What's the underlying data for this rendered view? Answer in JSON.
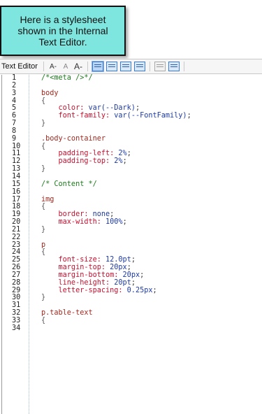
{
  "callout": {
    "text": "Here is a stylesheet shown in the Internal Text Editor."
  },
  "toolbar": {
    "title": "Text Editor",
    "font_decrease": "A-",
    "font_reset": "A",
    "font_increase": "A-"
  },
  "colors": {
    "callout_bg": "#7fe5df",
    "comment": "#1e7a1e",
    "selector": "#a4281e",
    "property": "#c8102e",
    "value": "#1d3aa6"
  },
  "lines": [
    {
      "n": "1",
      "tokens": [
        [
          "comment",
          "/*<meta />*/"
        ]
      ]
    },
    {
      "n": "2",
      "tokens": []
    },
    {
      "n": "3",
      "tokens": [
        [
          "sel",
          "body"
        ]
      ]
    },
    {
      "n": "4",
      "tokens": [
        [
          "brace",
          "{"
        ]
      ]
    },
    {
      "n": "5",
      "tokens": [
        [
          "prop",
          "    color: "
        ],
        [
          "val",
          "var(--Dark)"
        ],
        [
          "punct",
          ";"
        ]
      ]
    },
    {
      "n": "6",
      "tokens": [
        [
          "prop",
          "    font-family: "
        ],
        [
          "val",
          "var(--FontFamily)"
        ],
        [
          "punct",
          ";"
        ]
      ]
    },
    {
      "n": "7",
      "tokens": [
        [
          "brace",
          "}"
        ]
      ]
    },
    {
      "n": "8",
      "tokens": []
    },
    {
      "n": "9",
      "tokens": [
        [
          "sel",
          ".body-container"
        ]
      ]
    },
    {
      "n": "10",
      "tokens": [
        [
          "brace",
          "{"
        ]
      ]
    },
    {
      "n": "11",
      "tokens": [
        [
          "prop",
          "    padding-left: "
        ],
        [
          "val",
          "2%"
        ],
        [
          "punct",
          ";"
        ]
      ]
    },
    {
      "n": "12",
      "tokens": [
        [
          "prop",
          "    padding-top: "
        ],
        [
          "val",
          "2%"
        ],
        [
          "punct",
          ";"
        ]
      ]
    },
    {
      "n": "13",
      "tokens": [
        [
          "brace",
          "}"
        ]
      ]
    },
    {
      "n": "14",
      "tokens": []
    },
    {
      "n": "15",
      "tokens": [
        [
          "comment",
          "/* Content */"
        ]
      ]
    },
    {
      "n": "16",
      "tokens": []
    },
    {
      "n": "17",
      "tokens": [
        [
          "sel",
          "img"
        ]
      ]
    },
    {
      "n": "18",
      "tokens": [
        [
          "brace",
          "{"
        ]
      ]
    },
    {
      "n": "19",
      "tokens": [
        [
          "prop",
          "    border: "
        ],
        [
          "val",
          "none"
        ],
        [
          "punct",
          ";"
        ]
      ]
    },
    {
      "n": "20",
      "tokens": [
        [
          "prop",
          "    max-width: "
        ],
        [
          "val",
          "100%"
        ],
        [
          "punct",
          ";"
        ]
      ]
    },
    {
      "n": "21",
      "tokens": [
        [
          "brace",
          "}"
        ]
      ]
    },
    {
      "n": "22",
      "tokens": []
    },
    {
      "n": "23",
      "tokens": [
        [
          "sel",
          "p"
        ]
      ]
    },
    {
      "n": "24",
      "tokens": [
        [
          "brace",
          "{"
        ]
      ]
    },
    {
      "n": "25",
      "tokens": [
        [
          "prop",
          "    font-size: "
        ],
        [
          "val",
          "12.0pt"
        ],
        [
          "punct",
          ";"
        ]
      ]
    },
    {
      "n": "26",
      "tokens": [
        [
          "prop",
          "    margin-top: "
        ],
        [
          "val",
          "20px"
        ],
        [
          "punct",
          ";"
        ]
      ]
    },
    {
      "n": "27",
      "tokens": [
        [
          "prop",
          "    margin-bottom: "
        ],
        [
          "val",
          "20px"
        ],
        [
          "punct",
          ";"
        ]
      ]
    },
    {
      "n": "28",
      "tokens": [
        [
          "prop",
          "    line-height: "
        ],
        [
          "val",
          "20pt"
        ],
        [
          "punct",
          ";"
        ]
      ]
    },
    {
      "n": "29",
      "tokens": [
        [
          "prop",
          "    letter-spacing: "
        ],
        [
          "val",
          "0.25px"
        ],
        [
          "punct",
          ";"
        ]
      ]
    },
    {
      "n": "30",
      "tokens": [
        [
          "brace",
          "}"
        ]
      ]
    },
    {
      "n": "31",
      "tokens": []
    },
    {
      "n": "32",
      "tokens": [
        [
          "sel",
          "p.table-text"
        ]
      ]
    },
    {
      "n": "33",
      "tokens": [
        [
          "brace",
          "{"
        ]
      ]
    },
    {
      "n": "34",
      "tokens": []
    }
  ]
}
